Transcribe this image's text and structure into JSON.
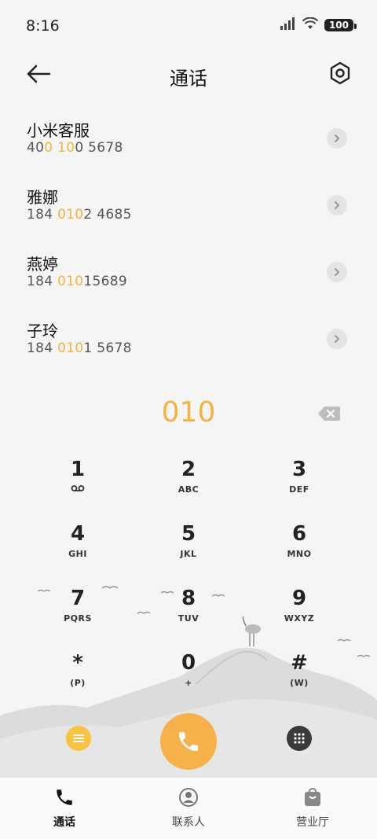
{
  "status_bar": {
    "time": "8:16",
    "battery": "100"
  },
  "header": {
    "title": "通话"
  },
  "contacts": [
    {
      "name": "小米客服",
      "number_parts": [
        "40",
        "0",
        " ",
        "10",
        "0 5678"
      ]
    },
    {
      "name": "雅娜",
      "number_parts": [
        "184 ",
        "010",
        "2 4685"
      ]
    },
    {
      "name": "燕婷",
      "number_parts": [
        "184 ",
        "010",
        "15689"
      ]
    },
    {
      "name": "子玲",
      "number_parts": [
        "184 ",
        "010",
        "1 5678"
      ]
    }
  ],
  "dial": {
    "number": "010"
  },
  "keypad": [
    {
      "digit": "1",
      "letters": ""
    },
    {
      "digit": "2",
      "letters": "ABC"
    },
    {
      "digit": "3",
      "letters": "DEF"
    },
    {
      "digit": "4",
      "letters": "GHI"
    },
    {
      "digit": "5",
      "letters": "JKL"
    },
    {
      "digit": "6",
      "letters": "MNO"
    },
    {
      "digit": "7",
      "letters": "PQRS"
    },
    {
      "digit": "8",
      "letters": "TUV"
    },
    {
      "digit": "9",
      "letters": "WXYZ"
    },
    {
      "digit": "*",
      "letters": "(P)"
    },
    {
      "digit": "0",
      "letters": "+"
    },
    {
      "digit": "#",
      "letters": "(W)"
    }
  ],
  "bottom_nav": [
    {
      "label": "通话",
      "icon": "phone-icon",
      "active": true
    },
    {
      "label": "联系人",
      "icon": "person-icon",
      "active": false
    },
    {
      "label": "营业厅",
      "icon": "shop-bag-icon",
      "active": false
    }
  ],
  "colors": {
    "accent": "#f2b440",
    "call_button": "#f6b14a",
    "background": "#f5f5f5"
  }
}
